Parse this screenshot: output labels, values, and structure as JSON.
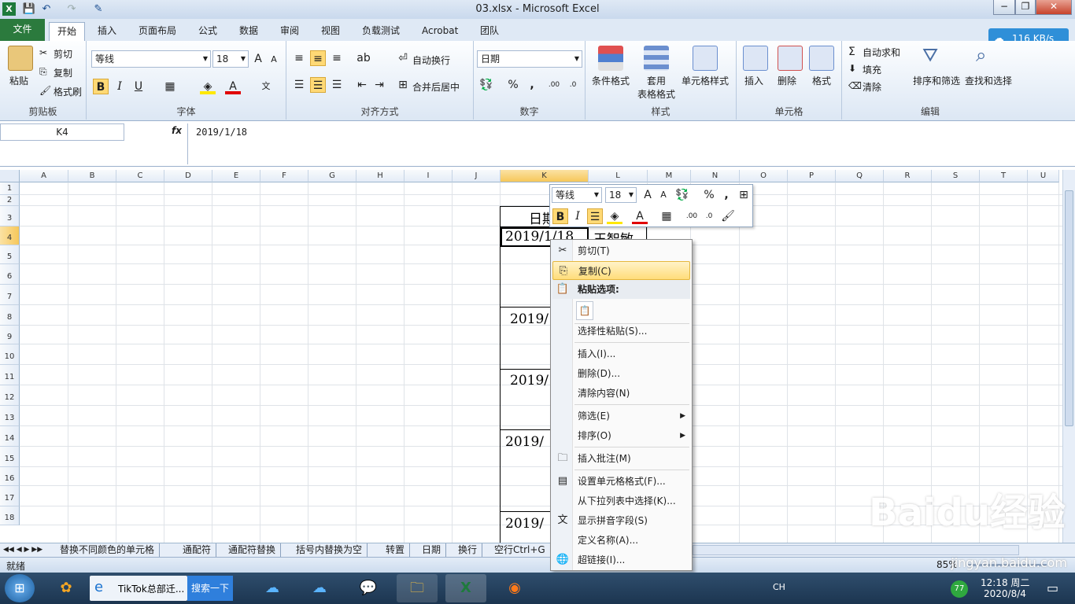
{
  "window": {
    "title": "03.xlsx - Microsoft Excel",
    "controls": {
      "minimize": "−",
      "restore": "❐",
      "close": "✕"
    }
  },
  "tabs": [
    "文件",
    "开始",
    "插入",
    "页面布局",
    "公式",
    "数据",
    "审阅",
    "视图",
    "负载测试",
    "Acrobat",
    "团队"
  ],
  "net_speed": "116 KB/s",
  "ribbon": {
    "clipboard": {
      "label": "剪贴板",
      "paste": "粘贴",
      "cut": "剪切",
      "copy": "复制",
      "format_painter": "格式刷"
    },
    "font": {
      "label": "字体",
      "name": "等线",
      "size": "18"
    },
    "alignment": {
      "label": "对齐方式",
      "wrap": "自动换行",
      "merge": "合并后居中"
    },
    "number": {
      "label": "数字",
      "format": "日期"
    },
    "styles": {
      "label": "样式",
      "conditional": "条件格式",
      "table": "套用\n表格格式",
      "table1": "套用",
      "table2": "表格格式",
      "cell_styles": "单元格样式"
    },
    "cells": {
      "label": "单元格",
      "insert": "插入",
      "delete": "删除",
      "format": "格式"
    },
    "editing": {
      "label": "编辑",
      "autosum": "自动求和",
      "fill": "填充",
      "clear": "清除",
      "sort": "排序和筛选",
      "find": "查找和选择"
    }
  },
  "formula": {
    "name_box": "K4",
    "fx": "fx",
    "value": "2019/1/18"
  },
  "columns": [
    "A",
    "B",
    "C",
    "D",
    "E",
    "F",
    "G",
    "H",
    "I",
    "J",
    "K",
    "L",
    "M",
    "N",
    "O",
    "P",
    "Q",
    "R",
    "S",
    "T",
    "U"
  ],
  "rows": [
    "1",
    "2",
    "3",
    "4",
    "5",
    "6",
    "7",
    "8",
    "9",
    "10",
    "11",
    "12",
    "13",
    "14",
    "15",
    "16",
    "17",
    "18"
  ],
  "cells": {
    "k3": "日期",
    "k4": "2019/1/18",
    "l4": "王智敏",
    "k8": "2019/",
    "k11": "2019/",
    "k14": "2019/",
    "k18": "2019/"
  },
  "mini_toolbar": {
    "font": "等线",
    "size": "18"
  },
  "context_menu": {
    "cut": "剪切(T)",
    "copy": "复制(C)",
    "paste_options": "粘贴选项:",
    "paste_special": "选择性粘贴(S)...",
    "insert": "插入(I)...",
    "delete": "删除(D)...",
    "clear": "清除内容(N)",
    "filter": "筛选(E)",
    "sort": "排序(O)",
    "insert_comment": "插入批注(M)",
    "format_cells": "设置单元格格式(F)...",
    "pick_list": "从下拉列表中选择(K)...",
    "phonetic": "显示拼音字段(S)",
    "define_name": "定义名称(A)...",
    "hyperlink": "超链接(I)..."
  },
  "sheet_tabs": [
    "替换不同颜色的单元格",
    "通配符",
    "通配符替换",
    "括号内替换为空",
    "转置",
    "日期",
    "换行",
    "空行Ctrl+G"
  ],
  "status": {
    "ready": "就绪",
    "zoom": "85%"
  },
  "taskbar": {
    "ie_title": "TikTok总部迁...",
    "search": "搜索一下",
    "lang": "CH",
    "time": "12:18 周二",
    "date": "2020/8/4",
    "badge": "77"
  },
  "watermark": {
    "brand": "Baidu经验",
    "url": "jingyan.baidu.com"
  }
}
